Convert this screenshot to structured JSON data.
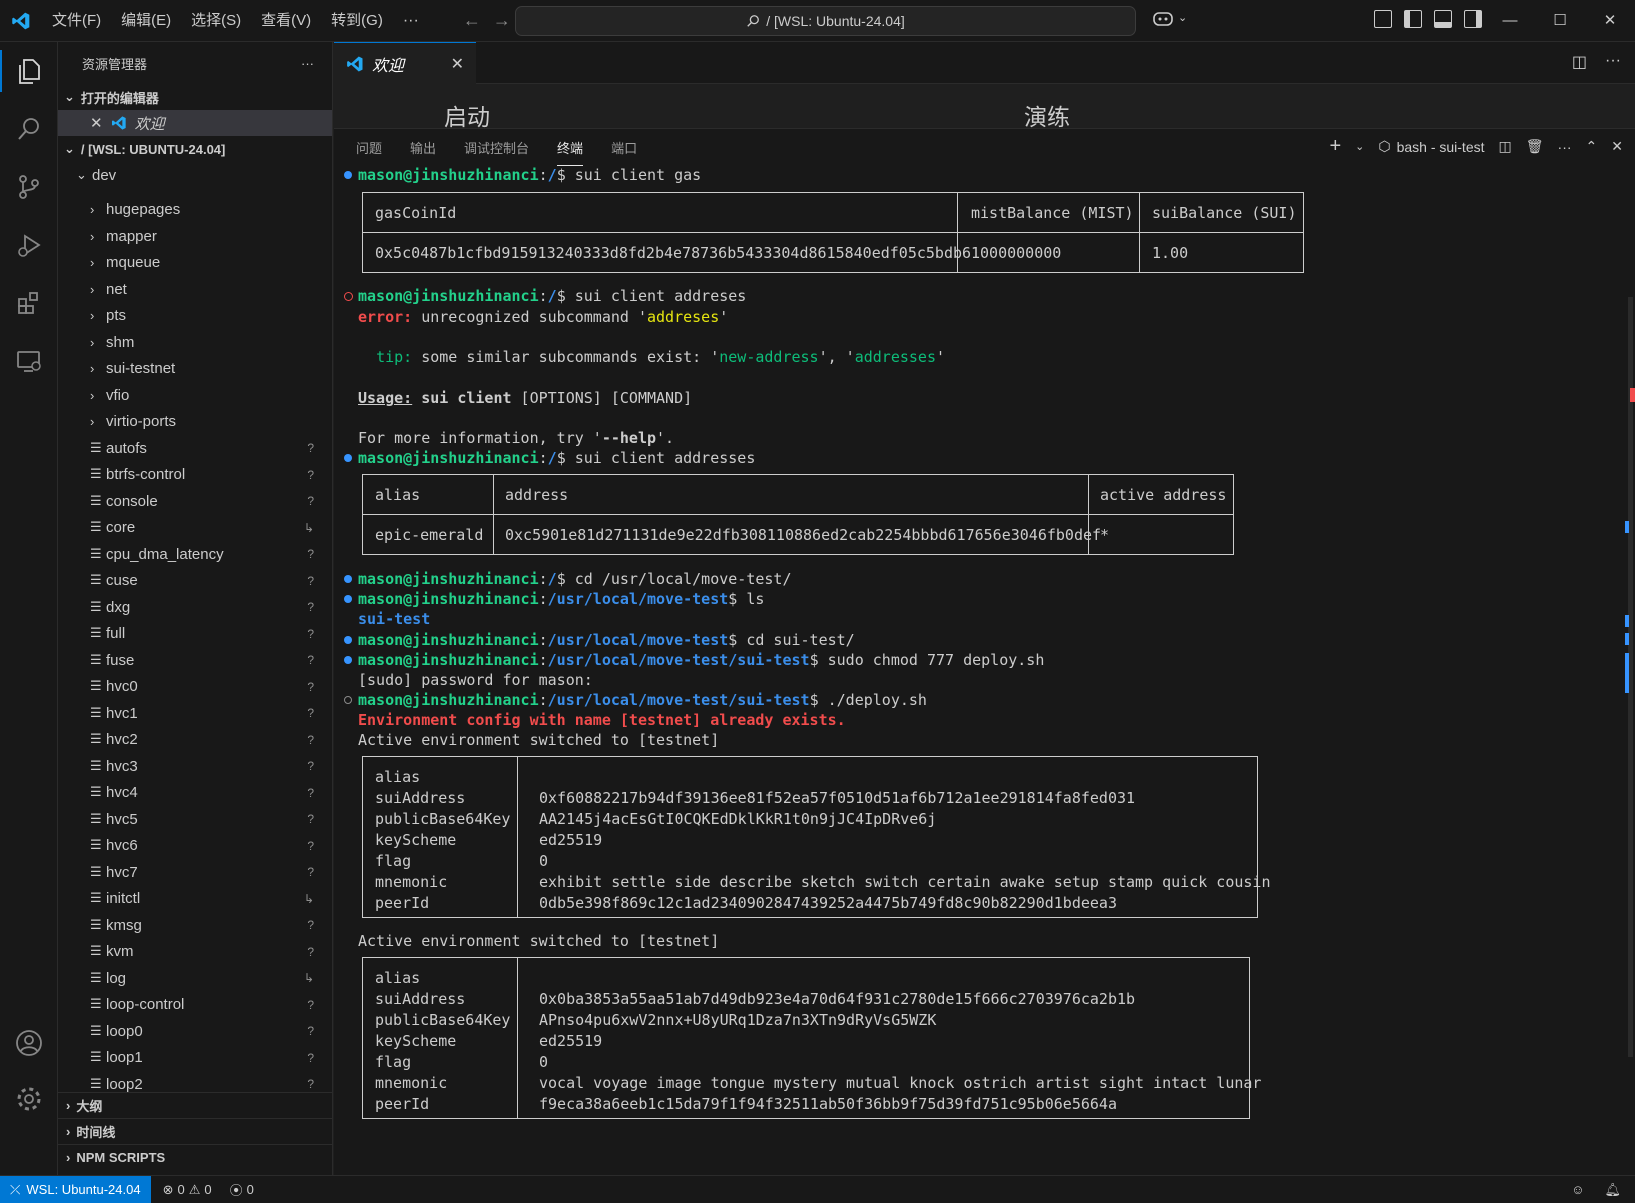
{
  "titlebar": {
    "menu": [
      "文件(F)",
      "编辑(E)",
      "选择(S)",
      "查看(V)",
      "转到(G)"
    ],
    "more": "···",
    "search": "/ [WSL: Ubuntu-24.04]",
    "min": "—",
    "max": "☐",
    "close": "✕",
    "colors": {
      "accent": "#0078d4",
      "logo": "#23a9f2"
    }
  },
  "sidebar": {
    "title": "资源管理器",
    "more": "···",
    "open_editors_label": "打开的编辑器",
    "open_editor_item": "欢迎",
    "workspace_label": "/ [WSL: UBUNTU-24.04]",
    "root_folder": "dev",
    "folders": [
      "hugepages",
      "mapper",
      "mqueue",
      "net",
      "pts",
      "shm",
      "sui-testnet",
      "vfio",
      "virtio-ports"
    ],
    "files": [
      {
        "name": "autofs",
        "badge": "?"
      },
      {
        "name": "btrfs-control",
        "badge": "?"
      },
      {
        "name": "console",
        "badge": "?"
      },
      {
        "name": "core",
        "badge": "↳"
      },
      {
        "name": "cpu_dma_latency",
        "badge": "?"
      },
      {
        "name": "cuse",
        "badge": "?"
      },
      {
        "name": "dxg",
        "badge": "?"
      },
      {
        "name": "full",
        "badge": "?"
      },
      {
        "name": "fuse",
        "badge": "?"
      },
      {
        "name": "hvc0",
        "badge": "?"
      },
      {
        "name": "hvc1",
        "badge": "?"
      },
      {
        "name": "hvc2",
        "badge": "?"
      },
      {
        "name": "hvc3",
        "badge": "?"
      },
      {
        "name": "hvc4",
        "badge": "?"
      },
      {
        "name": "hvc5",
        "badge": "?"
      },
      {
        "name": "hvc6",
        "badge": "?"
      },
      {
        "name": "hvc7",
        "badge": "?"
      },
      {
        "name": "initctl",
        "badge": "↳"
      },
      {
        "name": "kmsg",
        "badge": "?"
      },
      {
        "name": "kvm",
        "badge": "?"
      },
      {
        "name": "log",
        "badge": "↳"
      },
      {
        "name": "loop-control",
        "badge": "?"
      },
      {
        "name": "loop0",
        "badge": "?"
      },
      {
        "name": "loop1",
        "badge": "?"
      },
      {
        "name": "loop2",
        "badge": "?"
      }
    ],
    "outline_label": "大纲",
    "timeline_label": "时间线",
    "npm_label": "NPM SCRIPTS"
  },
  "editor": {
    "tab_label": "欢迎",
    "welcome_heading_1": "启动",
    "welcome_heading_2": "演练"
  },
  "panel": {
    "tabs": [
      "问题",
      "输出",
      "调试控制台",
      "终端",
      "端口"
    ],
    "active_tab": "终端",
    "terminal_name": "bash - sui-test"
  },
  "terminal": {
    "user": "mason@jinshuzhinanci",
    "cmd1": "sui client gas",
    "gas_table": {
      "headers": [
        "gasCoinId",
        "mistBalance (MIST)",
        "suiBalance (SUI)"
      ],
      "row": [
        "0x5c0487b1cfbd915913240333d8fd2b4e78736b5433304d8615840edf05c5bdb6",
        "1000000000",
        "1.00"
      ]
    },
    "cmd2": "sui client addreses",
    "error_label": "error:",
    "error_text": " unrecognized subcommand '",
    "error_arg": "addreses",
    "error_end": "'",
    "tip_label": "tip:",
    "tip_text": " some similar subcommands exist: '",
    "tip_opt1": "new-address",
    "tip_mid": "', '",
    "tip_opt2": "addresses",
    "tip_end": "'",
    "usage_label": "Usage:",
    "usage_cmd": " sui client",
    "usage_rest": " [OPTIONS] [COMMAND]",
    "help_pre": "For more information, try '",
    "help_flag": "--help",
    "help_post": "'.",
    "cmd3": "sui client addresses",
    "addr_table": {
      "headers": [
        "alias",
        "address",
        "active address"
      ],
      "row": [
        "epic-emerald",
        "0xc5901e81d271131de9e22dfb308110886ed2cab2254bbbd617656e3046fb0def",
        "*"
      ]
    },
    "cmd4": "cd /usr/local/move-test/",
    "path1": "/usr/local/move-test",
    "cmd5": "ls",
    "ls_output": "sui-test",
    "cmd6": "cd sui-test/",
    "path2": "/usr/local/move-test/sui-test",
    "cmd7": "sudo chmod 777 deploy.sh",
    "sudo_prompt": "[sudo] password for mason:",
    "cmd8": "./deploy.sh",
    "env_exists": "Environment config with name [testnet] already exists.",
    "env_switched": "Active environment switched to [testnet]",
    "env_switched_2": "Active environment switched to [testnet]",
    "key_labels": [
      "alias",
      "suiAddress",
      "publicBase64Key",
      "keyScheme",
      "flag",
      "mnemonic",
      "peerId"
    ],
    "key1_values": [
      "",
      "0xf60882217b94df39136ee81f52ea57f0510d51af6b712a1ee291814fa8fed031",
      "AA2145j4acEsGtI0CQKEdDklKkR1t0n9jJC4IpDRve6j",
      "ed25519",
      "0",
      "exhibit settle side describe sketch switch certain awake setup stamp quick cousin",
      "0db5e398f869c12c1ad2340902847439252a4475b749fd8c90b82290d1bdeea3"
    ],
    "key2_values": [
      "",
      "0x0ba3853a55aa51ab7d49db923e4a70d64f931c2780de15f666c2703976ca2b1b",
      "APnso4pu6xwV2nnx+U8yURq1Dza7n3XTn9dRyVsG5WZK",
      "ed25519",
      "0",
      "vocal voyage image tongue mystery mutual knock ostrich artist sight intact lunar",
      "f9eca38a6eeb1c15da79f1f94f32511ab50f36bb9f75d39fd751c95b06e5664a"
    ]
  },
  "statusbar": {
    "remote": "WSL: Ubuntu-24.04",
    "errors": "0",
    "warnings": "0",
    "ports": "0"
  }
}
